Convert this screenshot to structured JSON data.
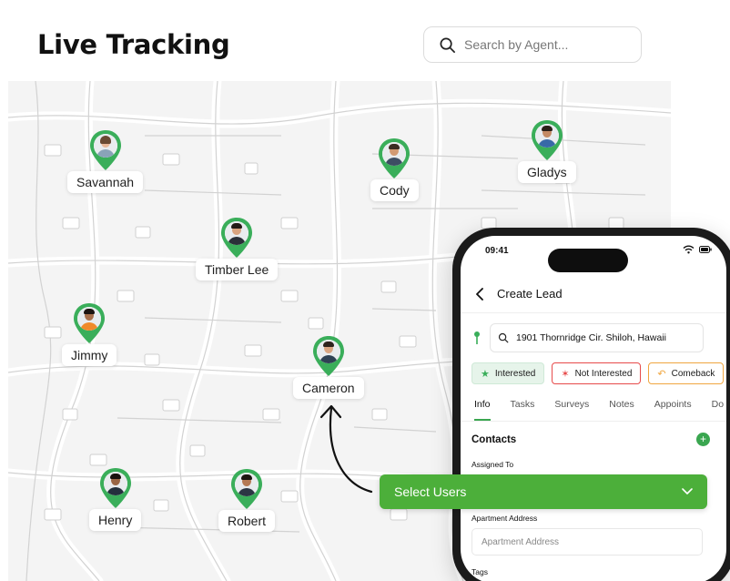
{
  "page": {
    "title": "Live Tracking"
  },
  "search": {
    "placeholder": "Search by Agent..."
  },
  "map": {
    "agents": [
      {
        "name": "Savannah",
        "skin": "#e8b899",
        "hair": "#6a4a33",
        "shirt": "#8aa3b8"
      },
      {
        "name": "Cody",
        "skin": "#d29a73",
        "hair": "#3b2b22",
        "shirt": "#3d4e63"
      },
      {
        "name": "Gladys",
        "skin": "#c48a64",
        "hair": "#2b2019",
        "shirt": "#3869a8"
      },
      {
        "name": "Timber Lee",
        "skin": "#d8a37f",
        "hair": "#231a15",
        "shirt": "#2a2f38"
      },
      {
        "name": "Jimmy",
        "skin": "#a86f4b",
        "hair": "#1d1410",
        "shirt": "#f08a2a"
      },
      {
        "name": "Cameron",
        "skin": "#d9a582",
        "hair": "#2e231d",
        "shirt": "#2f4154"
      },
      {
        "name": "Henry",
        "skin": "#9a6645",
        "hair": "#1a120e",
        "shirt": "#24303d"
      },
      {
        "name": "Robert",
        "skin": "#b57a55",
        "hair": "#1e1511",
        "shirt": "#2c3644"
      }
    ],
    "pin_color": "#3aae5a"
  },
  "phone": {
    "time": "09:41",
    "screen_title": "Create Lead",
    "address": "1901 Thornridge Cir. Shiloh, Hawaii",
    "chips": [
      {
        "label": "Interested",
        "style": "green"
      },
      {
        "label": "Not Interested",
        "style": "red"
      },
      {
        "label": "Comeback",
        "style": "orange"
      }
    ],
    "tabs": [
      "Info",
      "Tasks",
      "Surveys",
      "Notes",
      "Appoints",
      "Do"
    ],
    "active_tab": "Info",
    "contacts_title": "Contacts",
    "assigned_to_label": "Assigned To",
    "apartment_label": "Apartment Address",
    "apartment_placeholder": "Apartment Address",
    "tags_label": "Tags"
  },
  "select_users": {
    "label": "Select Users"
  },
  "colors": {
    "accent_green": "#4caf3a",
    "pin_green": "#3aae5a"
  }
}
